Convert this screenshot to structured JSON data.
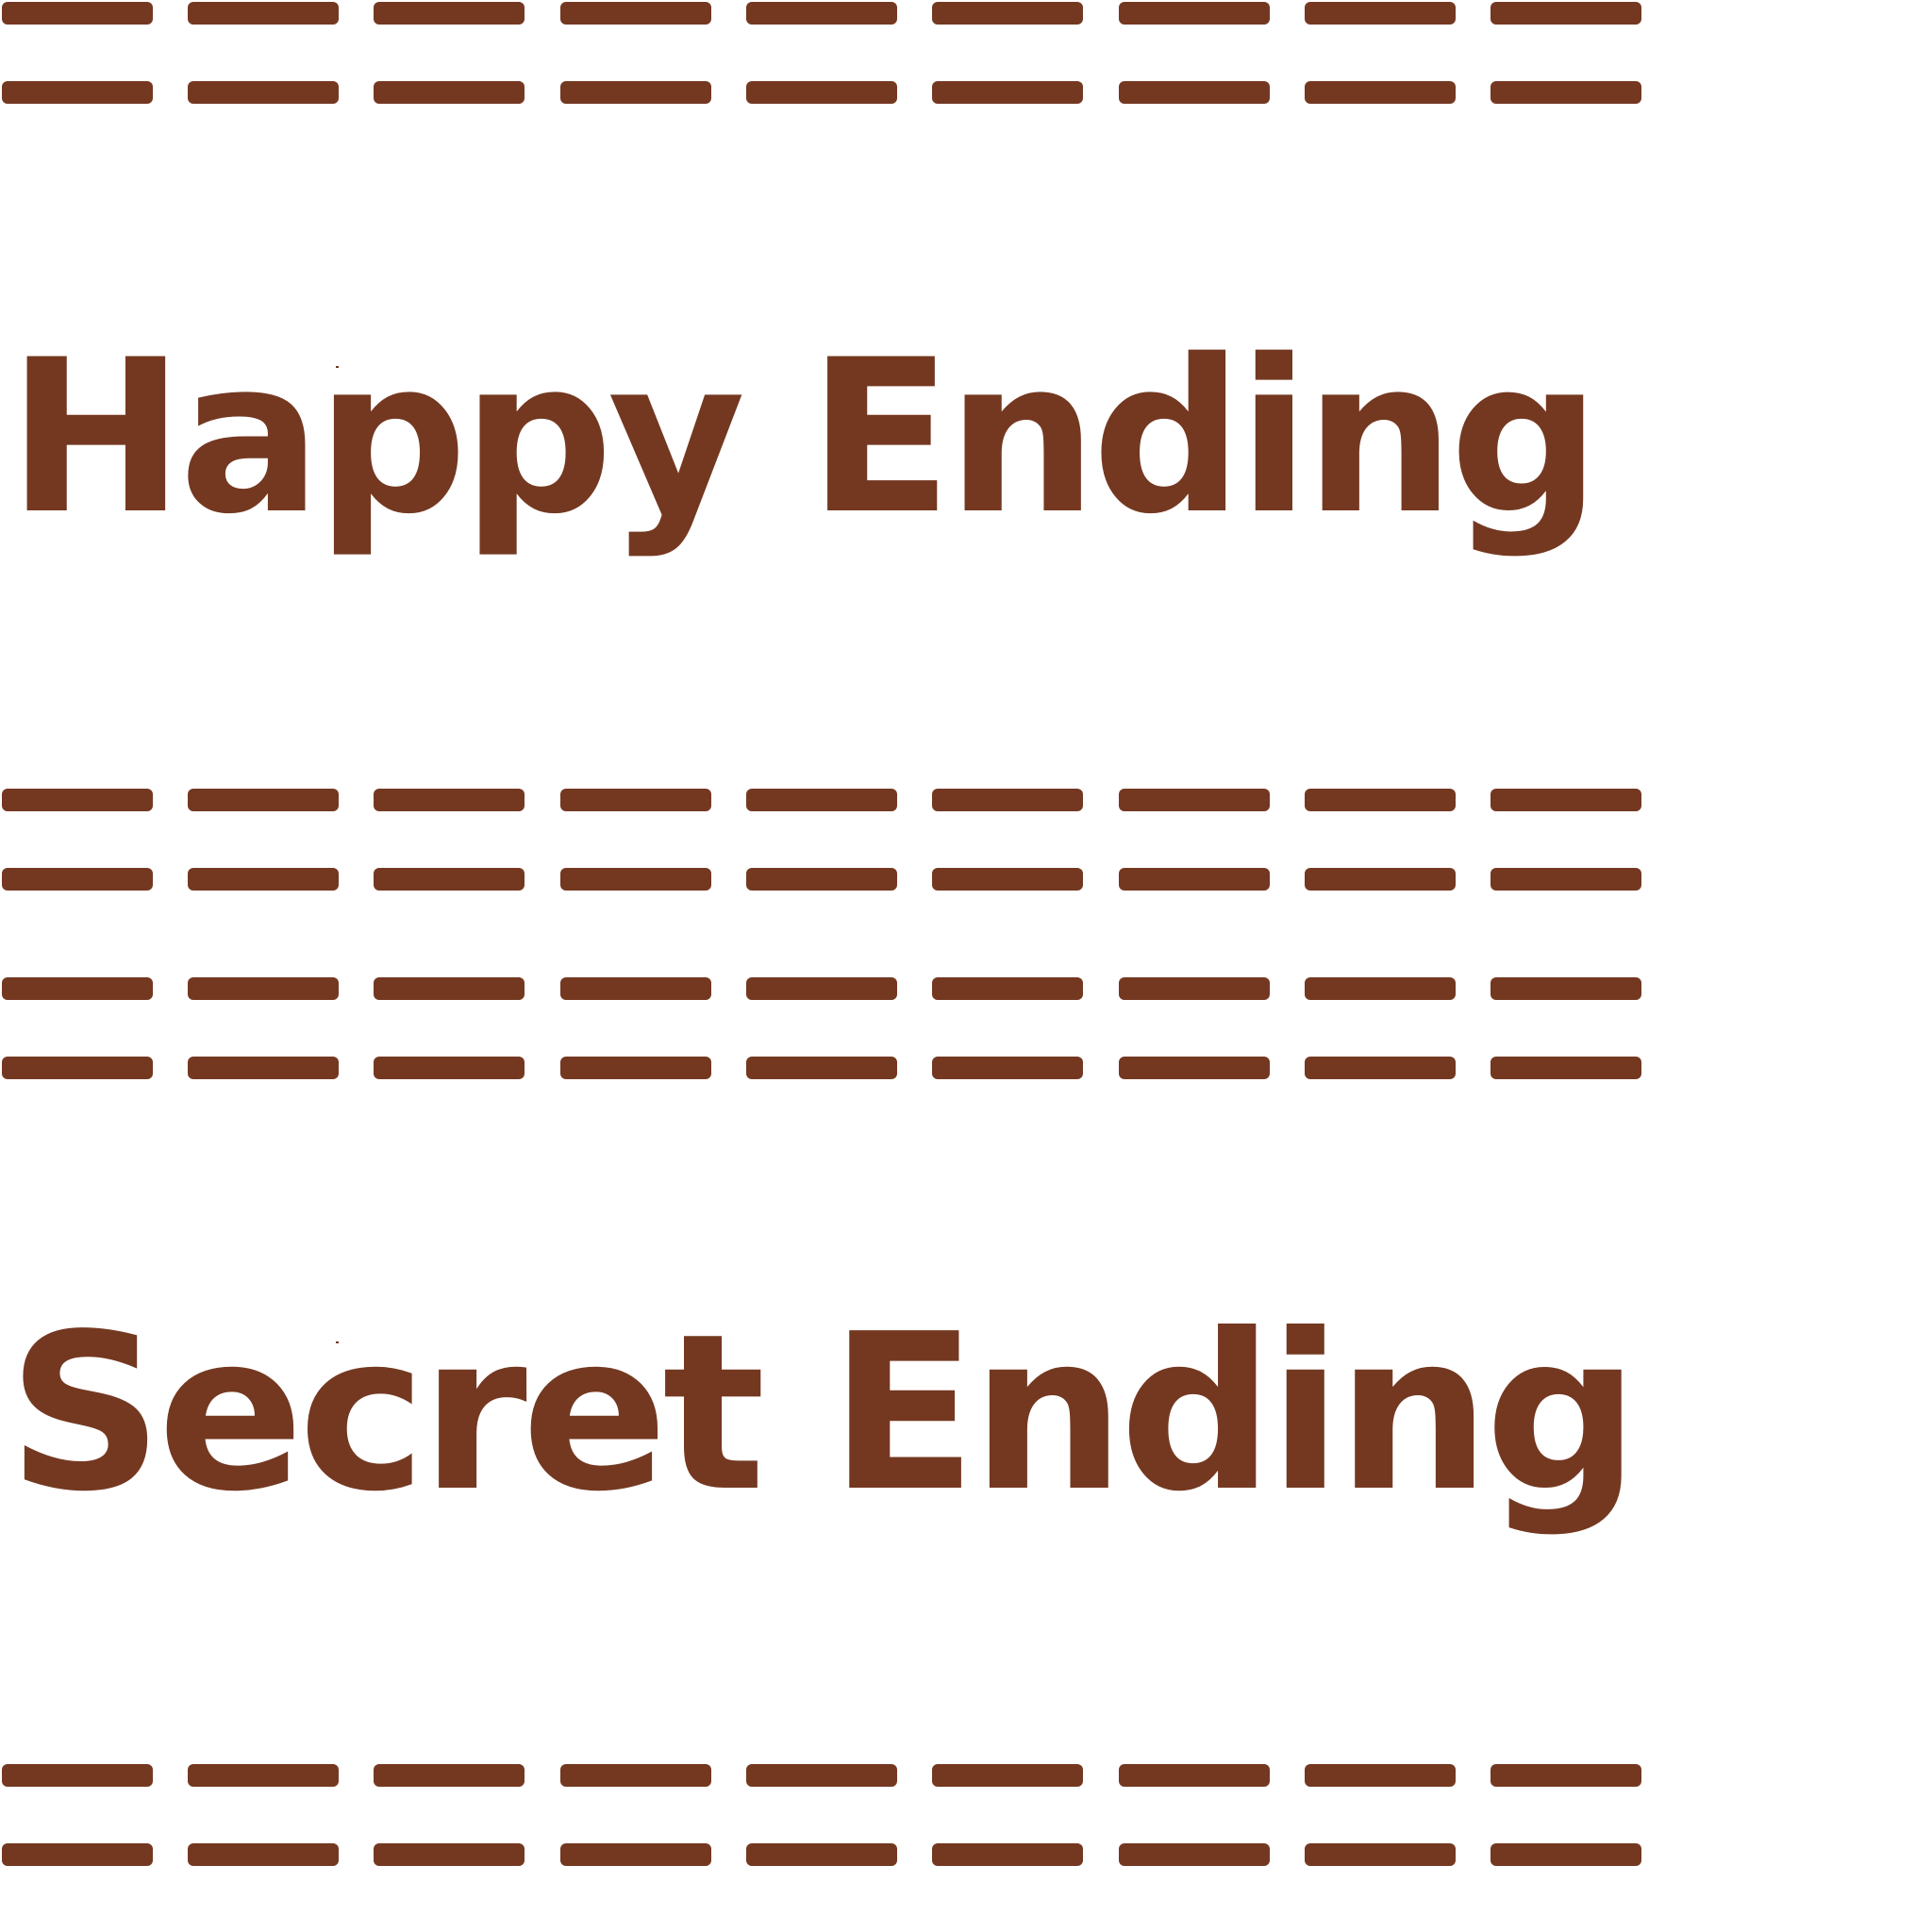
{
  "colors": {
    "ink": "#743821",
    "background": "#ffffff"
  },
  "titles": {
    "happy_ending": "Happy Ending",
    "secret_ending": "Secret Ending"
  }
}
